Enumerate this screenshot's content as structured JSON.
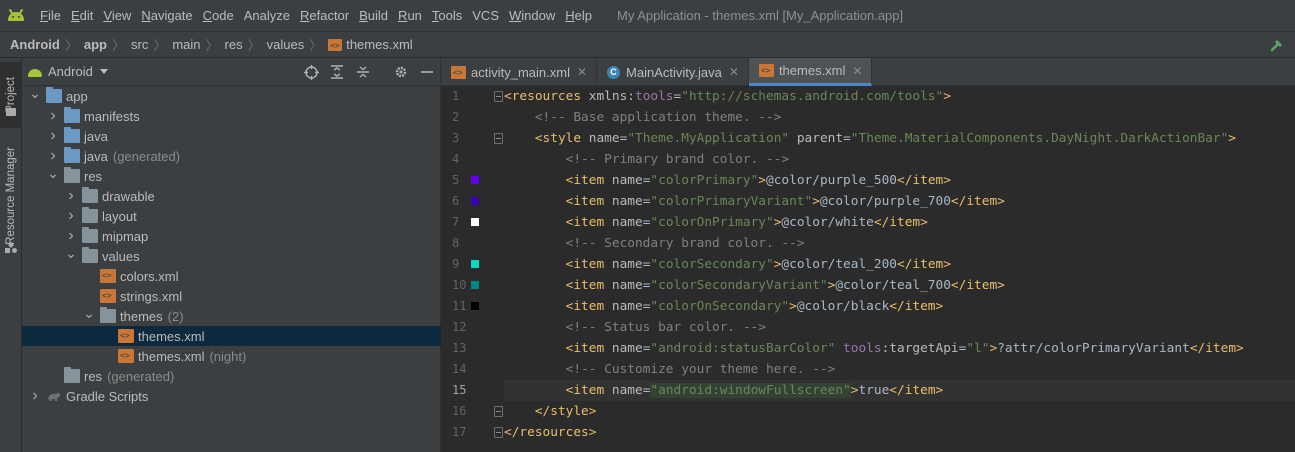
{
  "menubar": {
    "items": [
      {
        "u": "F",
        "rest": "ile"
      },
      {
        "u": "E",
        "rest": "dit"
      },
      {
        "u": "V",
        "rest": "iew"
      },
      {
        "u": "N",
        "rest": "avigate"
      },
      {
        "u": "C",
        "rest": "ode"
      },
      {
        "u": "",
        "rest": "Analyze"
      },
      {
        "u": "R",
        "rest": "efactor"
      },
      {
        "u": "B",
        "rest": "uild"
      },
      {
        "u": "R",
        "rest": "un"
      },
      {
        "u": "T",
        "rest": "ools"
      },
      {
        "u": "",
        "rest": "VCS"
      },
      {
        "u": "W",
        "rest": "indow"
      },
      {
        "u": "H",
        "rest": "elp"
      }
    ],
    "window_title": "My Application - themes.xml [My_Application.app]"
  },
  "breadcrumb": [
    "Android",
    "app",
    "src",
    "main",
    "res",
    "values",
    "themes.xml"
  ],
  "toolstrip": {
    "project": "Project",
    "resource_manager": "Resource Manager"
  },
  "project_panel": {
    "view_mode": "Android",
    "tree": [
      {
        "label": "app",
        "extra": "",
        "depth": 0,
        "arrow": "down",
        "icon": "folder-blue"
      },
      {
        "label": "manifests",
        "extra": "",
        "depth": 1,
        "arrow": "right",
        "icon": "folder-blue"
      },
      {
        "label": "java",
        "extra": "",
        "depth": 1,
        "arrow": "right",
        "icon": "folder-blue"
      },
      {
        "label": "java",
        "extra": "(generated)",
        "depth": 1,
        "arrow": "right",
        "icon": "folder-blue"
      },
      {
        "label": "res",
        "extra": "",
        "depth": 1,
        "arrow": "down",
        "icon": "folder-res"
      },
      {
        "label": "drawable",
        "extra": "",
        "depth": 2,
        "arrow": "right",
        "icon": "folder"
      },
      {
        "label": "layout",
        "extra": "",
        "depth": 2,
        "arrow": "right",
        "icon": "folder"
      },
      {
        "label": "mipmap",
        "extra": "",
        "depth": 2,
        "arrow": "right",
        "icon": "folder"
      },
      {
        "label": "values",
        "extra": "",
        "depth": 2,
        "arrow": "down",
        "icon": "folder"
      },
      {
        "label": "colors.xml",
        "extra": "",
        "depth": 3,
        "arrow": "",
        "icon": "xml"
      },
      {
        "label": "strings.xml",
        "extra": "",
        "depth": 3,
        "arrow": "",
        "icon": "xml"
      },
      {
        "label": "themes",
        "extra": "(2)",
        "depth": 3,
        "arrow": "down",
        "icon": "folder"
      },
      {
        "label": "themes.xml",
        "extra": "",
        "depth": 4,
        "arrow": "",
        "icon": "xml",
        "selected": true
      },
      {
        "label": "themes.xml",
        "extra": "(night)",
        "depth": 4,
        "arrow": "",
        "icon": "xml"
      },
      {
        "label": "res",
        "extra": "(generated)",
        "depth": 1,
        "arrow": "",
        "icon": "folder-res"
      },
      {
        "label": "Gradle Scripts",
        "extra": "",
        "depth": 0,
        "arrow": "right",
        "icon": "gradle"
      }
    ]
  },
  "editor": {
    "tabs": [
      {
        "label": "activity_main.xml",
        "icon": "xml",
        "active": false
      },
      {
        "label": "MainActivity.java",
        "icon": "class",
        "active": false
      },
      {
        "label": "themes.xml",
        "icon": "xml",
        "active": true
      }
    ],
    "current_line": 15,
    "lines": [
      {
        "n": "1",
        "fold": true,
        "parts": [
          [
            "tg",
            "<resources "
          ],
          [
            "at",
            "xmlns:"
          ],
          [
            "ns",
            "tools"
          ],
          [
            "tx",
            "="
          ],
          [
            "vl",
            "\"http://schemas.android.com/tools\""
          ],
          [
            "tg",
            ">"
          ]
        ]
      },
      {
        "n": "2",
        "parts": [
          [
            "tx",
            "    "
          ],
          [
            "cm",
            "<!-- Base application theme. -->"
          ]
        ]
      },
      {
        "n": "3",
        "fold": true,
        "parts": [
          [
            "tx",
            "    "
          ],
          [
            "tg",
            "<style "
          ],
          [
            "at",
            "name"
          ],
          [
            "tx",
            "="
          ],
          [
            "vl",
            "\"Theme.MyApplication\""
          ],
          [
            "tx",
            " "
          ],
          [
            "at",
            "parent"
          ],
          [
            "tx",
            "="
          ],
          [
            "vl",
            "\"Theme.MaterialComponents.DayNight.DarkActionBar\""
          ],
          [
            "tg",
            ">"
          ]
        ]
      },
      {
        "n": "4",
        "parts": [
          [
            "tx",
            "        "
          ],
          [
            "cm",
            "<!-- Primary brand color. -->"
          ]
        ]
      },
      {
        "n": "5",
        "swatch": "#6200ee",
        "parts": [
          [
            "tx",
            "        "
          ],
          [
            "tg",
            "<item "
          ],
          [
            "at",
            "name"
          ],
          [
            "tx",
            "="
          ],
          [
            "vl",
            "\"colorPrimary\""
          ],
          [
            "tg",
            ">"
          ],
          [
            "tx",
            "@color/purple_500"
          ],
          [
            "tg",
            "</item>"
          ]
        ]
      },
      {
        "n": "6",
        "swatch": "#3700b3",
        "parts": [
          [
            "tx",
            "        "
          ],
          [
            "tg",
            "<item "
          ],
          [
            "at",
            "name"
          ],
          [
            "tx",
            "="
          ],
          [
            "vl",
            "\"colorPrimaryVariant\""
          ],
          [
            "tg",
            ">"
          ],
          [
            "tx",
            "@color/purple_700"
          ],
          [
            "tg",
            "</item>"
          ]
        ]
      },
      {
        "n": "7",
        "swatch": "#ffffff",
        "parts": [
          [
            "tx",
            "        "
          ],
          [
            "tg",
            "<item "
          ],
          [
            "at",
            "name"
          ],
          [
            "tx",
            "="
          ],
          [
            "vl",
            "\"colorOnPrimary\""
          ],
          [
            "tg",
            ">"
          ],
          [
            "tx",
            "@color/white"
          ],
          [
            "tg",
            "</item>"
          ]
        ]
      },
      {
        "n": "8",
        "parts": [
          [
            "tx",
            "        "
          ],
          [
            "cm",
            "<!-- Secondary brand color. -->"
          ]
        ]
      },
      {
        "n": "9",
        "swatch": "#03dac5",
        "parts": [
          [
            "tx",
            "        "
          ],
          [
            "tg",
            "<item "
          ],
          [
            "at",
            "name"
          ],
          [
            "tx",
            "="
          ],
          [
            "vl",
            "\"colorSecondary\""
          ],
          [
            "tg",
            ">"
          ],
          [
            "tx",
            "@color/teal_200"
          ],
          [
            "tg",
            "</item>"
          ]
        ]
      },
      {
        "n": "10",
        "swatch": "#018786",
        "parts": [
          [
            "tx",
            "        "
          ],
          [
            "tg",
            "<item "
          ],
          [
            "at",
            "name"
          ],
          [
            "tx",
            "="
          ],
          [
            "vl",
            "\"colorSecondaryVariant\""
          ],
          [
            "tg",
            ">"
          ],
          [
            "tx",
            "@color/teal_700"
          ],
          [
            "tg",
            "</item>"
          ]
        ]
      },
      {
        "n": "11",
        "swatch": "#000000",
        "parts": [
          [
            "tx",
            "        "
          ],
          [
            "tg",
            "<item "
          ],
          [
            "at",
            "name"
          ],
          [
            "tx",
            "="
          ],
          [
            "vl",
            "\"colorOnSecondary\""
          ],
          [
            "tg",
            ">"
          ],
          [
            "tx",
            "@color/black"
          ],
          [
            "tg",
            "</item>"
          ]
        ]
      },
      {
        "n": "12",
        "parts": [
          [
            "tx",
            "        "
          ],
          [
            "cm",
            "<!-- Status bar color. -->"
          ]
        ]
      },
      {
        "n": "13",
        "parts": [
          [
            "tx",
            "        "
          ],
          [
            "tg",
            "<item "
          ],
          [
            "at",
            "name"
          ],
          [
            "tx",
            "="
          ],
          [
            "vl",
            "\"android:statusBarColor\""
          ],
          [
            "tx",
            " "
          ],
          [
            "ns",
            "tools"
          ],
          [
            "at",
            ":targetApi"
          ],
          [
            "tx",
            "="
          ],
          [
            "vl",
            "\"l\""
          ],
          [
            "tg",
            ">"
          ],
          [
            "tx",
            "?attr/colorPrimaryVariant"
          ],
          [
            "tg",
            "</item>"
          ]
        ]
      },
      {
        "n": "14",
        "parts": [
          [
            "tx",
            "        "
          ],
          [
            "cm",
            "<!-- Customize your theme here. -->"
          ]
        ]
      },
      {
        "n": "15",
        "parts": [
          [
            "tx",
            "        "
          ],
          [
            "tg",
            "<item "
          ],
          [
            "at",
            "name"
          ],
          [
            "tx",
            "="
          ],
          [
            "vl hl",
            "\"android:windowFullscreen\""
          ],
          [
            "tg",
            ">"
          ],
          [
            "tx",
            "true"
          ],
          [
            "tg",
            "</item>"
          ]
        ]
      },
      {
        "n": "16",
        "fold": true,
        "parts": [
          [
            "tx",
            "    "
          ],
          [
            "tg",
            "</style>"
          ]
        ]
      },
      {
        "n": "17",
        "fold": true,
        "parts": [
          [
            "tg",
            "</resources>"
          ]
        ]
      }
    ]
  }
}
